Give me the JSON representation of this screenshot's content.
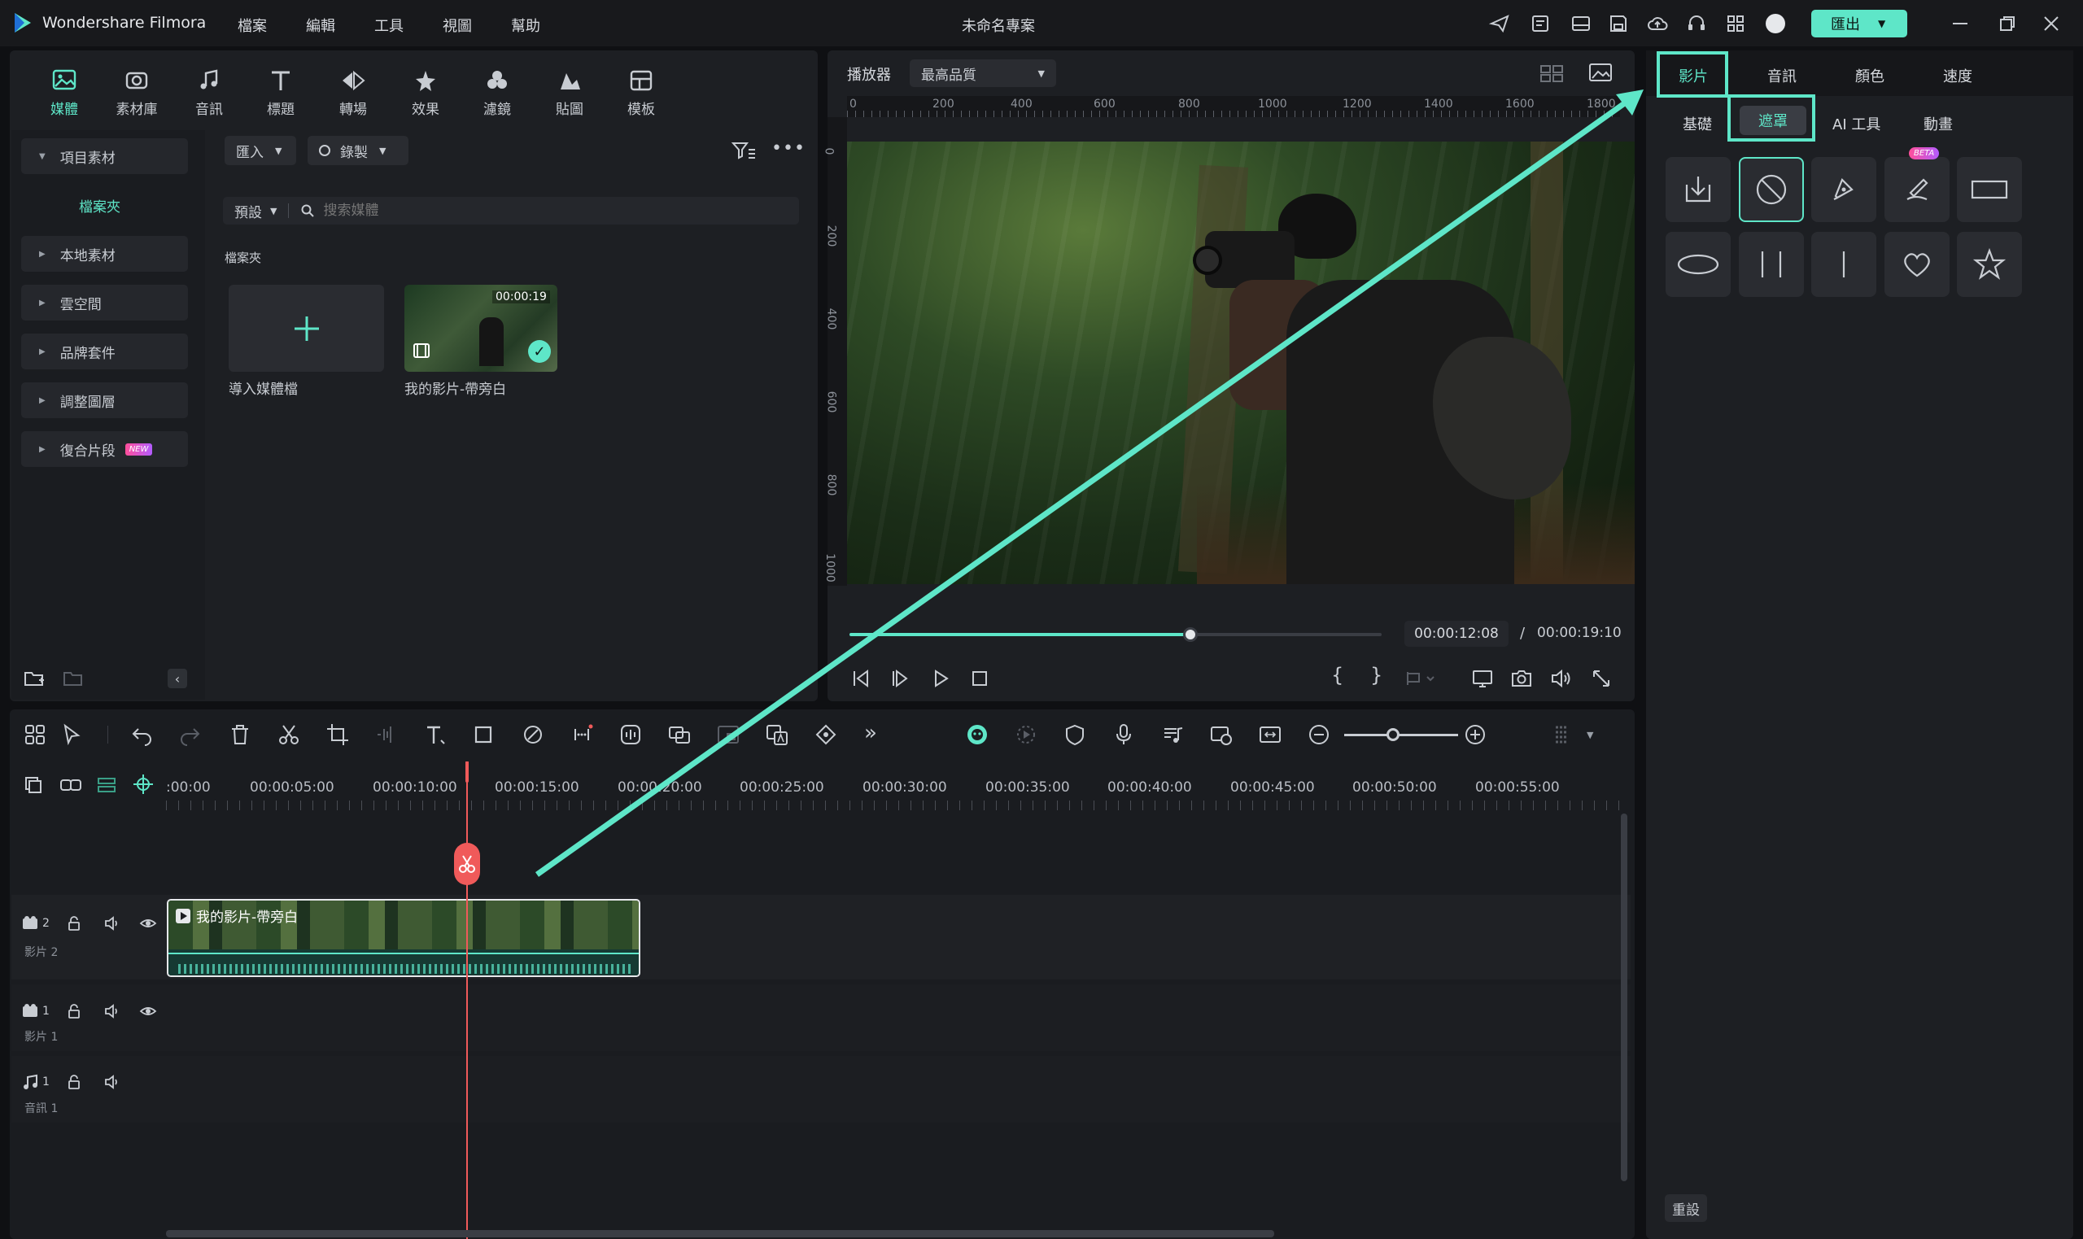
{
  "app": {
    "name": "Wondershare Filmora",
    "project_title": "未命名專案",
    "export_label": "匯出"
  },
  "menu": [
    "檔案",
    "編輯",
    "工具",
    "視圖",
    "幫助"
  ],
  "media_tabs": [
    {
      "label": "媒體",
      "icon": "media-icon",
      "active": true
    },
    {
      "label": "素材庫",
      "icon": "stock-icon"
    },
    {
      "label": "音訊",
      "icon": "music-note-icon"
    },
    {
      "label": "標題",
      "icon": "title-t-icon"
    },
    {
      "label": "轉場",
      "icon": "transition-icon"
    },
    {
      "label": "效果",
      "icon": "effects-icon"
    },
    {
      "label": "濾鏡",
      "icon": "filter-icon"
    },
    {
      "label": "貼圖",
      "icon": "sticker-icon"
    },
    {
      "label": "模板",
      "icon": "template-icon"
    }
  ],
  "sidebar": {
    "project_media": "項目素材",
    "folder": "檔案夾",
    "items": [
      "本地素材",
      "雲空間",
      "品牌套件",
      "調整圖層",
      "復合片段"
    ],
    "new_badge": "NEW"
  },
  "media": {
    "import_label": "匯入",
    "record_label": "錄製",
    "sort_label": "預設",
    "search_placeholder": "搜索媒體",
    "folder_heading": "檔案夾",
    "import_tile_label": "導入媒體檔",
    "clip_name": "我的影片-帶旁白",
    "clip_duration": "00:00:19"
  },
  "player": {
    "label": "播放器",
    "quality": "最高品質",
    "ruler_h": [
      "0",
      "200",
      "400",
      "600",
      "800",
      "1000",
      "1200",
      "1400",
      "1600",
      "1800"
    ],
    "ruler_v": [
      "0",
      "200",
      "400",
      "600",
      "800",
      "1000"
    ],
    "current_time": "00:00:12:08",
    "separator": "/",
    "total_time": "00:00:19:10",
    "progress": 0.64
  },
  "right_panel": {
    "tabs": [
      "影片",
      "音訊",
      "顏色",
      "速度"
    ],
    "active_tab": "影片",
    "subtabs": [
      "基礎",
      "遮罩",
      "AI 工具",
      "動畫"
    ],
    "active_subtab": "遮罩",
    "beta_badge": "BETA",
    "reset_label": "重設"
  },
  "timeline": {
    "timecodes": [
      ":00:00",
      "00:00:05:00",
      "00:00:10:00",
      "00:00:15:00",
      "00:00:20:00",
      "00:00:25:00",
      "00:00:30:00",
      "00:00:35:00",
      "00:00:40:00",
      "00:00:45:00",
      "00:00:50:00",
      "00:00:55:00"
    ],
    "tracks": [
      {
        "num": "2",
        "name": "影片 2"
      },
      {
        "num": "1",
        "name": "影片 1"
      },
      {
        "num": "1",
        "name": "音訊 1"
      }
    ],
    "clip_label": "我的影片-帶旁白"
  },
  "colors": {
    "accent": "#5ee6c8",
    "playhead": "#f05a5a",
    "export_bg": "#5ee6c8"
  }
}
